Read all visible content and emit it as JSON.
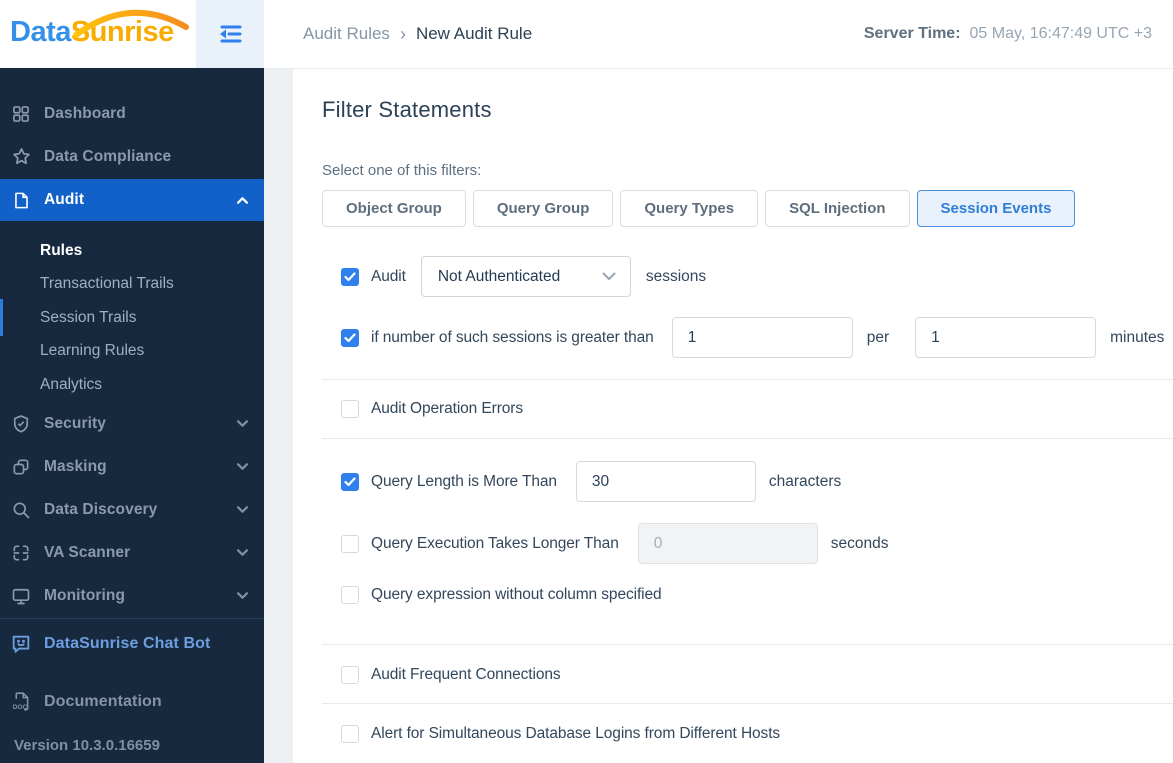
{
  "logo": {
    "part1": "Data",
    "part2": "Sunrise"
  },
  "header": {
    "breadcrumb": {
      "parent": "Audit Rules",
      "separator": "›",
      "current": "New Audit Rule"
    },
    "server_time": {
      "label": "Server Time:",
      "value": "05 May, 16:47:49  UTC +3"
    }
  },
  "sidebar": {
    "items": [
      {
        "label": "Dashboard",
        "icon": "grid-icon"
      },
      {
        "label": "Data Compliance",
        "icon": "star-icon"
      },
      {
        "label": "Audit",
        "icon": "file-icon",
        "active": true,
        "chevron": "up"
      },
      {
        "label": "Security",
        "icon": "shield-icon",
        "chevron": "down"
      },
      {
        "label": "Masking",
        "icon": "mask-icon",
        "chevron": "down"
      },
      {
        "label": "Data Discovery",
        "icon": "search-icon",
        "chevron": "down"
      },
      {
        "label": "VA Scanner",
        "icon": "scanner-icon",
        "chevron": "down"
      },
      {
        "label": "Monitoring",
        "icon": "monitor-icon",
        "chevron": "down"
      }
    ],
    "audit_submenu": [
      {
        "label": "Rules",
        "active": true
      },
      {
        "label": "Transactional Trails"
      },
      {
        "label": "Session Trails"
      },
      {
        "label": "Learning Rules"
      },
      {
        "label": "Analytics"
      }
    ],
    "footer": {
      "chat_bot": "DataSunrise Chat Bot",
      "documentation": "Documentation",
      "version": "Version 10.3.0.16659"
    }
  },
  "main": {
    "title": "Filter Statements",
    "filter_prompt": "Select one of this filters:",
    "filter_tabs": [
      {
        "label": "Object Group",
        "selected": false
      },
      {
        "label": "Query Group",
        "selected": false
      },
      {
        "label": "Query Types",
        "selected": false
      },
      {
        "label": "SQL Injection",
        "selected": false
      },
      {
        "label": "Session Events",
        "selected": true
      }
    ],
    "rows": {
      "audit_sessions": {
        "checked": true,
        "label": "Audit",
        "dropdown_value": "Not Authenticated",
        "suffix": "sessions"
      },
      "session_count": {
        "checked": true,
        "label": "if number of such sessions is greater than",
        "count_value": "1",
        "per_label": "per",
        "period_value": "1",
        "suffix": "minutes"
      },
      "operation_errors": {
        "checked": false,
        "label": "Audit Operation Errors"
      },
      "query_length": {
        "checked": true,
        "label": "Query Length is More Than",
        "value": "30",
        "suffix": "characters"
      },
      "query_execution": {
        "checked": false,
        "label": "Query Execution Takes Longer Than",
        "value": "0",
        "suffix": "seconds",
        "disabled": true
      },
      "query_expression": {
        "checked": false,
        "label": "Query expression without column specified"
      },
      "frequent_connections": {
        "checked": false,
        "label": "Audit Frequent Connections"
      },
      "simultaneous_logins": {
        "checked": false,
        "label": "Alert for Simultaneous Database Logins from Different Hosts"
      }
    }
  },
  "colors": {
    "accent": "#2f80ed",
    "active_nav": "#1261c9",
    "sidebar_bg": "#17293e",
    "logo_blue": "#3490e8",
    "logo_orange": "#f9ac00",
    "selected_tab_bg": "#e9f2fc",
    "selected_tab_text": "#2f7ed8"
  }
}
